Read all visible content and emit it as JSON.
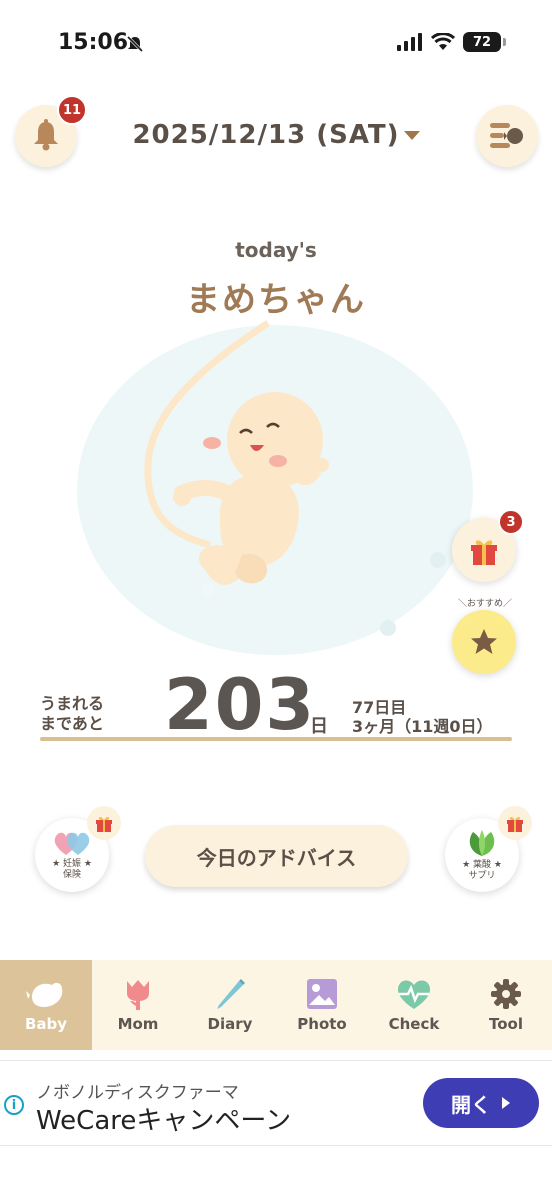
{
  "status_bar": {
    "time": "15:06",
    "battery": "72"
  },
  "header": {
    "date": "2025/12/13 (SAT)",
    "notification_count": "11"
  },
  "baby": {
    "heading": "today's",
    "name": "まめちゃん"
  },
  "gift": {
    "count": "3"
  },
  "recommend_label": "＼おすすめ／",
  "countdown": {
    "label_line1": "うまれる",
    "label_line2": "まであと",
    "days_left": "203",
    "unit": "日",
    "day_count": "77日目",
    "month_week": "3ヶ月（11週0日）"
  },
  "advice_button": "今日のアドバイス",
  "left_widget": {
    "line1": "★ 妊娠 ★",
    "line2": "保険"
  },
  "right_widget": {
    "line1": "★ 葉酸 ★",
    "line2": "サプリ"
  },
  "tabs": [
    {
      "label": "Baby",
      "icon": "bird-icon"
    },
    {
      "label": "Mom",
      "icon": "tulip-icon"
    },
    {
      "label": "Diary",
      "icon": "pencil-icon"
    },
    {
      "label": "Photo",
      "icon": "photo-icon"
    },
    {
      "label": "Check",
      "icon": "heartbeat-icon"
    },
    {
      "label": "Tool",
      "icon": "gear-icon"
    }
  ],
  "ad": {
    "sponsor": "ノボノルディスクファーマ",
    "title": "WeCareキャンペーン",
    "button": "開く"
  },
  "colors": {
    "accent": "#dcc399",
    "badge": "#c0342b",
    "name": "#a07a55",
    "ad_button": "#3f3db3"
  }
}
